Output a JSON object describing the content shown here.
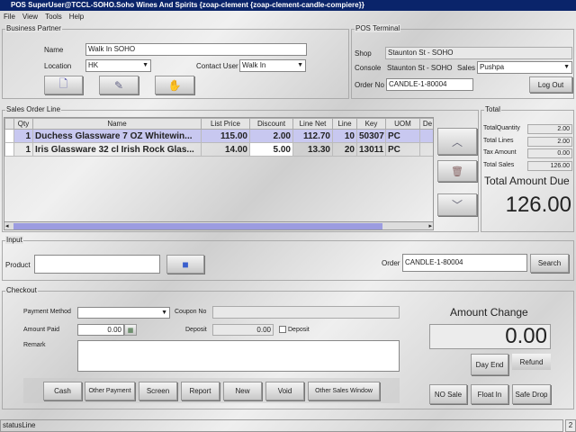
{
  "window": {
    "title": "POS  SuperUser@TCCL-SOHO.Soho Wines And Spirits {zoap-clement {zoap-clement-candle-compiere}}"
  },
  "menu": [
    "File",
    "View",
    "Tools",
    "Help"
  ],
  "business_partner": {
    "legend": "Business Partner",
    "name_label": "Name",
    "name_value": "Walk In SOHO",
    "location_label": "Location",
    "location_value": "HK",
    "contact_label": "Contact User",
    "contact_value": "Walk In"
  },
  "pos_terminal": {
    "legend": "POS Terminal",
    "shop_label": "Shop",
    "shop_value": "Staunton St - SOHO",
    "console_label": "Console",
    "console_value": "Staunton St - SOHO",
    "sales_label": "Sales",
    "sales_value": "Pushpa",
    "order_label": "Order No",
    "order_value": "CANDLE-1-80004",
    "logout": "Log Out"
  },
  "sales_order_line": {
    "legend": "Sales Order Line",
    "columns": [
      "Qty",
      "Name",
      "List Price",
      "Discount",
      "Line Net",
      "Line",
      "Key",
      "UOM",
      "De"
    ],
    "rows": [
      [
        "1",
        "Duchess Glassware  7 OZ   Whitewin...",
        "115.00",
        "2.00",
        "112.70",
        "10",
        "50307",
        "PC",
        ""
      ],
      [
        "1",
        "Iris Glassware  32 cl   Irish Rock Glas...",
        "14.00",
        "5.00",
        "13.30",
        "20",
        "13011",
        "PC",
        ""
      ]
    ]
  },
  "total": {
    "legend": "Total",
    "qty_label": "TotalQuantity",
    "qty": "2.00",
    "lines_label": "Total Lines",
    "lines": "2.00",
    "tax_label": "Tax Amount",
    "tax": "0.00",
    "sales_label": "Total Sales",
    "sales": "126.00",
    "due_label": "Total Amount Due",
    "due": "126.00"
  },
  "input": {
    "legend": "Input",
    "product_label": "Product",
    "product_value": "",
    "order_label": "Order",
    "order_value": "CANDLE-1-80004",
    "search": "Search"
  },
  "checkout": {
    "legend": "Checkout",
    "payment_label": "Payment Method",
    "payment_value": "",
    "coupon_label": "Coupon No",
    "coupon_value": "",
    "paid_label": "Amount Paid",
    "paid_value": "0.00",
    "deposit_label": "Deposit",
    "deposit_value": "0.00",
    "deposit_check": "Deposit",
    "remark_label": "Remark",
    "change_label": "Amount Change",
    "change_value": "0.00",
    "buttons": [
      "Cash",
      "Other Payment",
      "Screen",
      "Report",
      "New",
      "Void",
      "Other Sales Window"
    ],
    "day_end": "Day End",
    "refund": "Refund",
    "no_sale": "NO Sale",
    "float_in": "Float In",
    "safe_drop": "Safe Drop"
  },
  "status": {
    "text": "statusLine",
    "count": "2"
  }
}
